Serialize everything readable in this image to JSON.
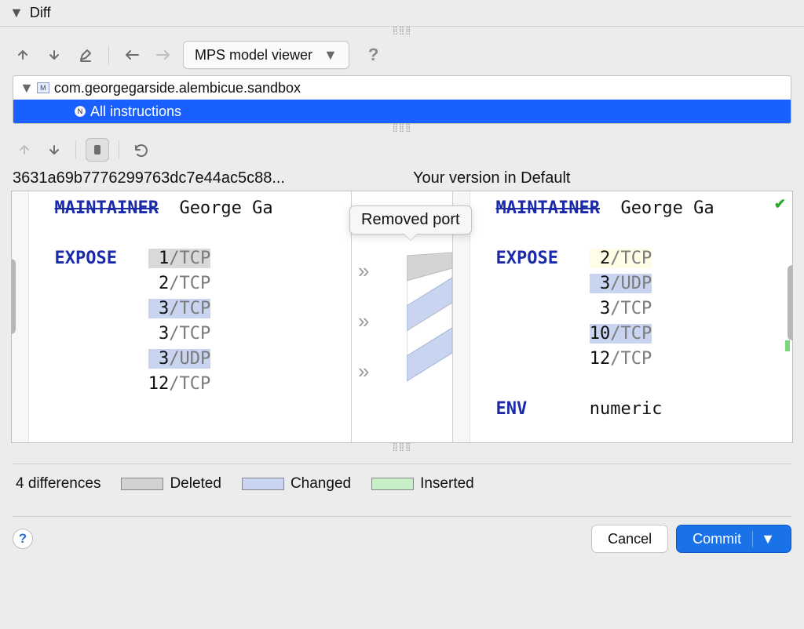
{
  "header": {
    "title": "Diff"
  },
  "toolbar1": {
    "viewer_label": "MPS model viewer"
  },
  "tree": {
    "module": "com.georgegarside.alembicue.sandbox",
    "node": "All instructions"
  },
  "titles": {
    "left": "3631a69b7776299763dc7e44ac5c88...",
    "right": "Your version in Default"
  },
  "tooltip": "Removed port",
  "diff": {
    "left": {
      "maintainer_kw": "MAINTAINER",
      "maintainer_val": "George Ga",
      "expose_kw": "EXPOSE",
      "ports": [
        {
          "n": "1",
          "p": "TCP",
          "hl": "del"
        },
        {
          "n": "2",
          "p": "TCP",
          "hl": ""
        },
        {
          "n": "3",
          "p": "TCP",
          "hl": "chg"
        },
        {
          "n": "3",
          "p": "TCP",
          "hl": ""
        },
        {
          "n": "3",
          "p": "UDP",
          "hl": "chg"
        },
        {
          "n": "12",
          "p": "TCP",
          "hl": ""
        }
      ]
    },
    "right": {
      "maintainer_kw": "MAINTAINER",
      "maintainer_val": "George Ga",
      "expose_kw": "EXPOSE",
      "ports": [
        {
          "n": "2",
          "p": "TCP",
          "hl": "yel"
        },
        {
          "n": "3",
          "p": "UDP",
          "hl": "chg"
        },
        {
          "n": "3",
          "p": "TCP",
          "hl": ""
        },
        {
          "n": "10",
          "p": "TCP",
          "hl": "chg"
        },
        {
          "n": "12",
          "p": "TCP",
          "hl": ""
        }
      ],
      "env_kw": "ENV",
      "env_val": "numeric"
    }
  },
  "legend": {
    "count": "4 differences",
    "deleted": "Deleted",
    "changed": "Changed",
    "inserted": "Inserted"
  },
  "footer": {
    "cancel": "Cancel",
    "commit": "Commit"
  }
}
